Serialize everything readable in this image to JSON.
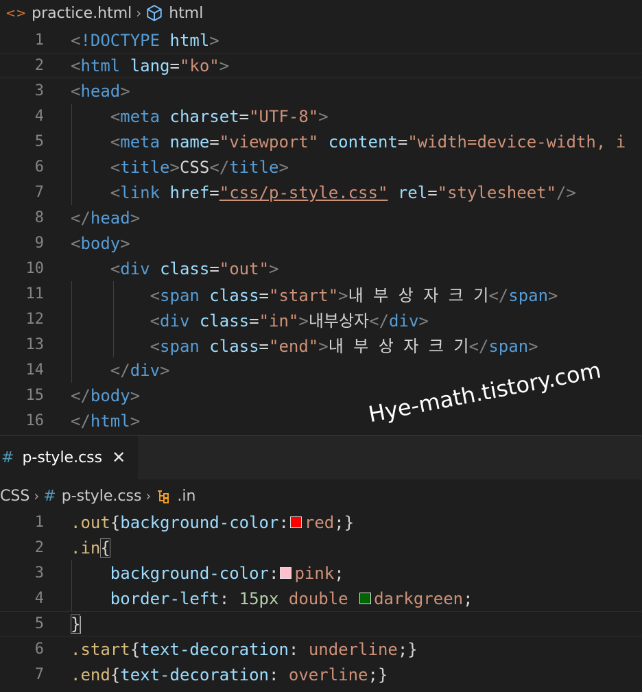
{
  "html_editor": {
    "breadcrumb": {
      "file": "practice.html",
      "element": "html"
    },
    "lines": [
      {
        "n": "1",
        "tokens": [
          [
            "p",
            "<"
          ],
          [
            "t",
            "!DOCTYPE"
          ],
          [
            "w",
            " "
          ],
          [
            "a",
            "html"
          ],
          [
            "p",
            ">"
          ]
        ]
      },
      {
        "n": "2",
        "active": true,
        "tokens": [
          [
            "p",
            "<"
          ],
          [
            "t",
            "html"
          ],
          [
            "w",
            " "
          ],
          [
            "a",
            "lang"
          ],
          [
            "w",
            "="
          ],
          [
            "s",
            "\"ko\""
          ],
          [
            "p",
            ">"
          ]
        ]
      },
      {
        "n": "3",
        "tokens": [
          [
            "p",
            "<"
          ],
          [
            "t",
            "head"
          ],
          [
            "p",
            ">"
          ]
        ]
      },
      {
        "n": "4",
        "tokens": [
          [
            "w",
            "    "
          ],
          [
            "p",
            "<"
          ],
          [
            "t",
            "meta"
          ],
          [
            "w",
            " "
          ],
          [
            "a",
            "charset"
          ],
          [
            "w",
            "="
          ],
          [
            "s",
            "\"UTF-8\""
          ],
          [
            "p",
            ">"
          ]
        ]
      },
      {
        "n": "5",
        "tokens": [
          [
            "w",
            "    "
          ],
          [
            "p",
            "<"
          ],
          [
            "t",
            "meta"
          ],
          [
            "w",
            " "
          ],
          [
            "a",
            "name"
          ],
          [
            "w",
            "="
          ],
          [
            "s",
            "\"viewport\""
          ],
          [
            "w",
            " "
          ],
          [
            "a",
            "content"
          ],
          [
            "w",
            "="
          ],
          [
            "s",
            "\"width=device-width, i"
          ]
        ]
      },
      {
        "n": "6",
        "tokens": [
          [
            "w",
            "    "
          ],
          [
            "p",
            "<"
          ],
          [
            "t",
            "title"
          ],
          [
            "p",
            ">"
          ],
          [
            "w",
            "CSS"
          ],
          [
            "p",
            "</"
          ],
          [
            "t",
            "title"
          ],
          [
            "p",
            ">"
          ]
        ]
      },
      {
        "n": "7",
        "tokens": [
          [
            "w",
            "    "
          ],
          [
            "p",
            "<"
          ],
          [
            "t",
            "link"
          ],
          [
            "w",
            " "
          ],
          [
            "a",
            "href"
          ],
          [
            "w",
            "="
          ],
          [
            "s und",
            "\"css/p-style.css\""
          ],
          [
            "w",
            " "
          ],
          [
            "a",
            "rel"
          ],
          [
            "w",
            "="
          ],
          [
            "s",
            "\"stylesheet\""
          ],
          [
            "p",
            "/>"
          ]
        ]
      },
      {
        "n": "8",
        "tokens": [
          [
            "p",
            "</"
          ],
          [
            "t",
            "head"
          ],
          [
            "p",
            ">"
          ]
        ]
      },
      {
        "n": "9",
        "tokens": [
          [
            "p",
            "<"
          ],
          [
            "t",
            "body"
          ],
          [
            "p",
            ">"
          ]
        ]
      },
      {
        "n": "10",
        "tokens": [
          [
            "w",
            "    "
          ],
          [
            "p",
            "<"
          ],
          [
            "t",
            "div"
          ],
          [
            "w",
            " "
          ],
          [
            "a",
            "class"
          ],
          [
            "w",
            "="
          ],
          [
            "s",
            "\"out\""
          ],
          [
            "p",
            ">"
          ]
        ]
      },
      {
        "n": "11",
        "tokens": [
          [
            "w",
            "        "
          ],
          [
            "p",
            "<"
          ],
          [
            "t",
            "span"
          ],
          [
            "w",
            " "
          ],
          [
            "a",
            "class"
          ],
          [
            "w",
            "="
          ],
          [
            "s",
            "\"start\""
          ],
          [
            "p",
            ">"
          ],
          [
            "w",
            "내 부 상 자 크 기"
          ],
          [
            "p",
            "</"
          ],
          [
            "t",
            "span"
          ],
          [
            "p",
            ">"
          ]
        ]
      },
      {
        "n": "12",
        "tokens": [
          [
            "w",
            "        "
          ],
          [
            "p",
            "<"
          ],
          [
            "t",
            "div"
          ],
          [
            "w",
            " "
          ],
          [
            "a",
            "class"
          ],
          [
            "w",
            "="
          ],
          [
            "s",
            "\"in\""
          ],
          [
            "p",
            ">"
          ],
          [
            "w",
            "내부상자"
          ],
          [
            "p",
            "</"
          ],
          [
            "t",
            "div"
          ],
          [
            "p",
            ">"
          ]
        ]
      },
      {
        "n": "13",
        "tokens": [
          [
            "w",
            "        "
          ],
          [
            "p",
            "<"
          ],
          [
            "t",
            "span"
          ],
          [
            "w",
            " "
          ],
          [
            "a",
            "class"
          ],
          [
            "w",
            "="
          ],
          [
            "s",
            "\"end\""
          ],
          [
            "p",
            ">"
          ],
          [
            "w",
            "내 부 상 자 크 기"
          ],
          [
            "p",
            "</"
          ],
          [
            "t",
            "span"
          ],
          [
            "p",
            ">"
          ]
        ]
      },
      {
        "n": "14",
        "tokens": [
          [
            "w",
            "    "
          ],
          [
            "p",
            "</"
          ],
          [
            "t",
            "div"
          ],
          [
            "p",
            ">"
          ]
        ]
      },
      {
        "n": "15",
        "tokens": [
          [
            "p",
            "</"
          ],
          [
            "t",
            "body"
          ],
          [
            "p",
            ">"
          ]
        ]
      },
      {
        "n": "16",
        "tokens": [
          [
            "p",
            "</"
          ],
          [
            "t",
            "html"
          ],
          [
            "p",
            ">"
          ]
        ]
      }
    ]
  },
  "watermark": "Hye-math.tistory.com",
  "css_tab": {
    "label": "p-style.css",
    "close_glyph": "✕"
  },
  "css_editor": {
    "breadcrumb": {
      "folder": "CSS",
      "file": "p-style.css",
      "selector": ".in"
    },
    "lines": [
      {
        "n": "1",
        "tokens": [
          [
            "sel",
            ".out"
          ],
          [
            "w",
            "{"
          ],
          [
            "a",
            "background-color"
          ],
          [
            "w",
            ":"
          ],
          [
            "sw",
            "#ff0000"
          ],
          [
            "s",
            "red"
          ],
          [
            "w",
            ";}"
          ]
        ]
      },
      {
        "n": "2",
        "tokens": [
          [
            "sel",
            ".in"
          ],
          [
            "w match",
            "{"
          ]
        ]
      },
      {
        "n": "3",
        "tokens": [
          [
            "w",
            "    "
          ],
          [
            "a",
            "background-color"
          ],
          [
            "w",
            ":"
          ],
          [
            "sw",
            "#ffc0cb"
          ],
          [
            "s",
            "pink"
          ],
          [
            "w",
            ";"
          ]
        ]
      },
      {
        "n": "4",
        "tokens": [
          [
            "w",
            "    "
          ],
          [
            "a",
            "border-left"
          ],
          [
            "w",
            ": "
          ],
          [
            "n",
            "15px"
          ],
          [
            "w",
            " "
          ],
          [
            "s",
            "double"
          ],
          [
            "w",
            " "
          ],
          [
            "sw",
            "#006400"
          ],
          [
            "s",
            "darkgreen"
          ],
          [
            "w",
            ";"
          ]
        ]
      },
      {
        "n": "5",
        "active": true,
        "tokens": [
          [
            "w match",
            "}"
          ],
          [
            "cursor",
            ""
          ]
        ]
      },
      {
        "n": "6",
        "tokens": [
          [
            "sel",
            ".start"
          ],
          [
            "w",
            "{"
          ],
          [
            "a",
            "text-decoration"
          ],
          [
            "w",
            ": "
          ],
          [
            "s",
            "underline"
          ],
          [
            "w",
            ";}"
          ]
        ]
      },
      {
        "n": "7",
        "tokens": [
          [
            "sel",
            ".end"
          ],
          [
            "w",
            "{"
          ],
          [
            "a",
            "text-decoration"
          ],
          [
            "w",
            ": "
          ],
          [
            "s",
            "overline"
          ],
          [
            "w",
            ";}"
          ]
        ]
      }
    ]
  },
  "colors": {
    "editor_bg": "#1e1e1e",
    "tag": "#569cd6",
    "attr": "#9cdcfe",
    "string": "#ce9178",
    "selector": "#d7ba7d",
    "number": "#b5cea8"
  },
  "icons": {
    "html_file": "code-brackets-icon",
    "element": "cube-icon",
    "css_file": "hash-icon",
    "selector": "symbol-class-icon",
    "separator": "chevron-right-icon"
  }
}
